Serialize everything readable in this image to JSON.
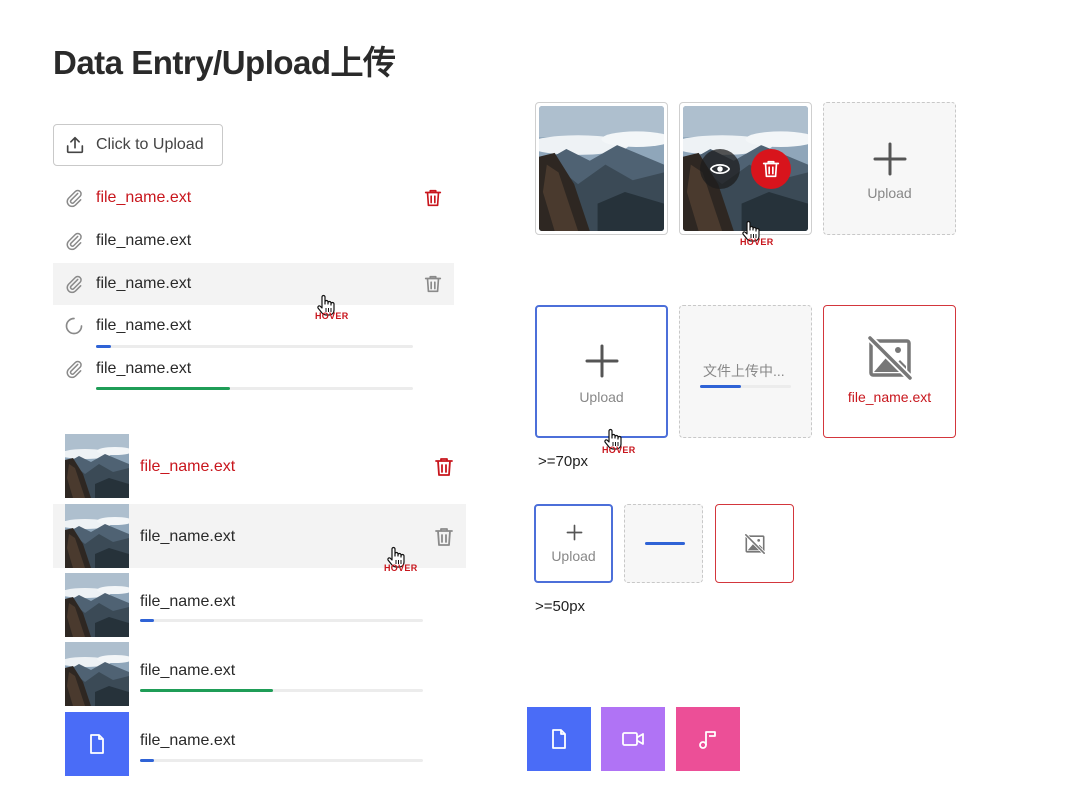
{
  "title": "Data Entry/Upload上传",
  "upload_button": {
    "label": "Click to Upload",
    "icon": "upload-icon"
  },
  "hover_label": "HOVER",
  "file_list": [
    {
      "name": "file_name.ext",
      "state": "error",
      "icon": "paperclip-icon",
      "action_icon": "trash-icon"
    },
    {
      "name": "file_name.ext",
      "state": "done",
      "icon": "paperclip-icon"
    },
    {
      "name": "file_name.ext",
      "state": "hover",
      "icon": "paperclip-icon",
      "action_icon": "trash-icon"
    },
    {
      "name": "file_name.ext",
      "state": "uploading",
      "icon": "spinner-icon",
      "progress": 0.04
    },
    {
      "name": "file_name.ext",
      "state": "success",
      "icon": "paperclip-icon",
      "progress": 0.42
    }
  ],
  "thumb_list": [
    {
      "name": "file_name.ext",
      "state": "error",
      "thumb": "mountain-photo",
      "action_icon": "trash-icon"
    },
    {
      "name": "file_name.ext",
      "state": "hover",
      "thumb": "mountain-photo",
      "action_icon": "trash-icon"
    },
    {
      "name": "file_name.ext",
      "state": "uploading",
      "thumb": "mountain-photo",
      "progress": 0.05
    },
    {
      "name": "file_name.ext",
      "state": "success",
      "thumb": "mountain-photo",
      "progress": 0.47
    },
    {
      "name": "file_name.ext",
      "state": "uploading",
      "thumb": "file-icon",
      "progress": 0.05
    }
  ],
  "card_grid": {
    "upload_label": "Upload",
    "preview_icon": "eye-icon",
    "delete_icon": "trash-icon"
  },
  "card_states": {
    "upload_label": "Upload",
    "uploading_text": "文件上传中...",
    "uploading_progress": 0.45,
    "error_name": "file_name.ext",
    "size_note": ">=70px"
  },
  "small_cards": {
    "upload_label": "Upload",
    "size_note": ">=50px"
  },
  "file_type_tiles": [
    {
      "icon": "document-icon",
      "color": "#4a6cf7"
    },
    {
      "icon": "video-icon",
      "color": "#b073f5"
    },
    {
      "icon": "music-icon",
      "color": "#ec4f97"
    }
  ],
  "colors": {
    "error": "#c8161d",
    "progress_blue": "#2f63d6",
    "progress_green": "#1f9d57",
    "active_border": "#4c6fd9"
  }
}
